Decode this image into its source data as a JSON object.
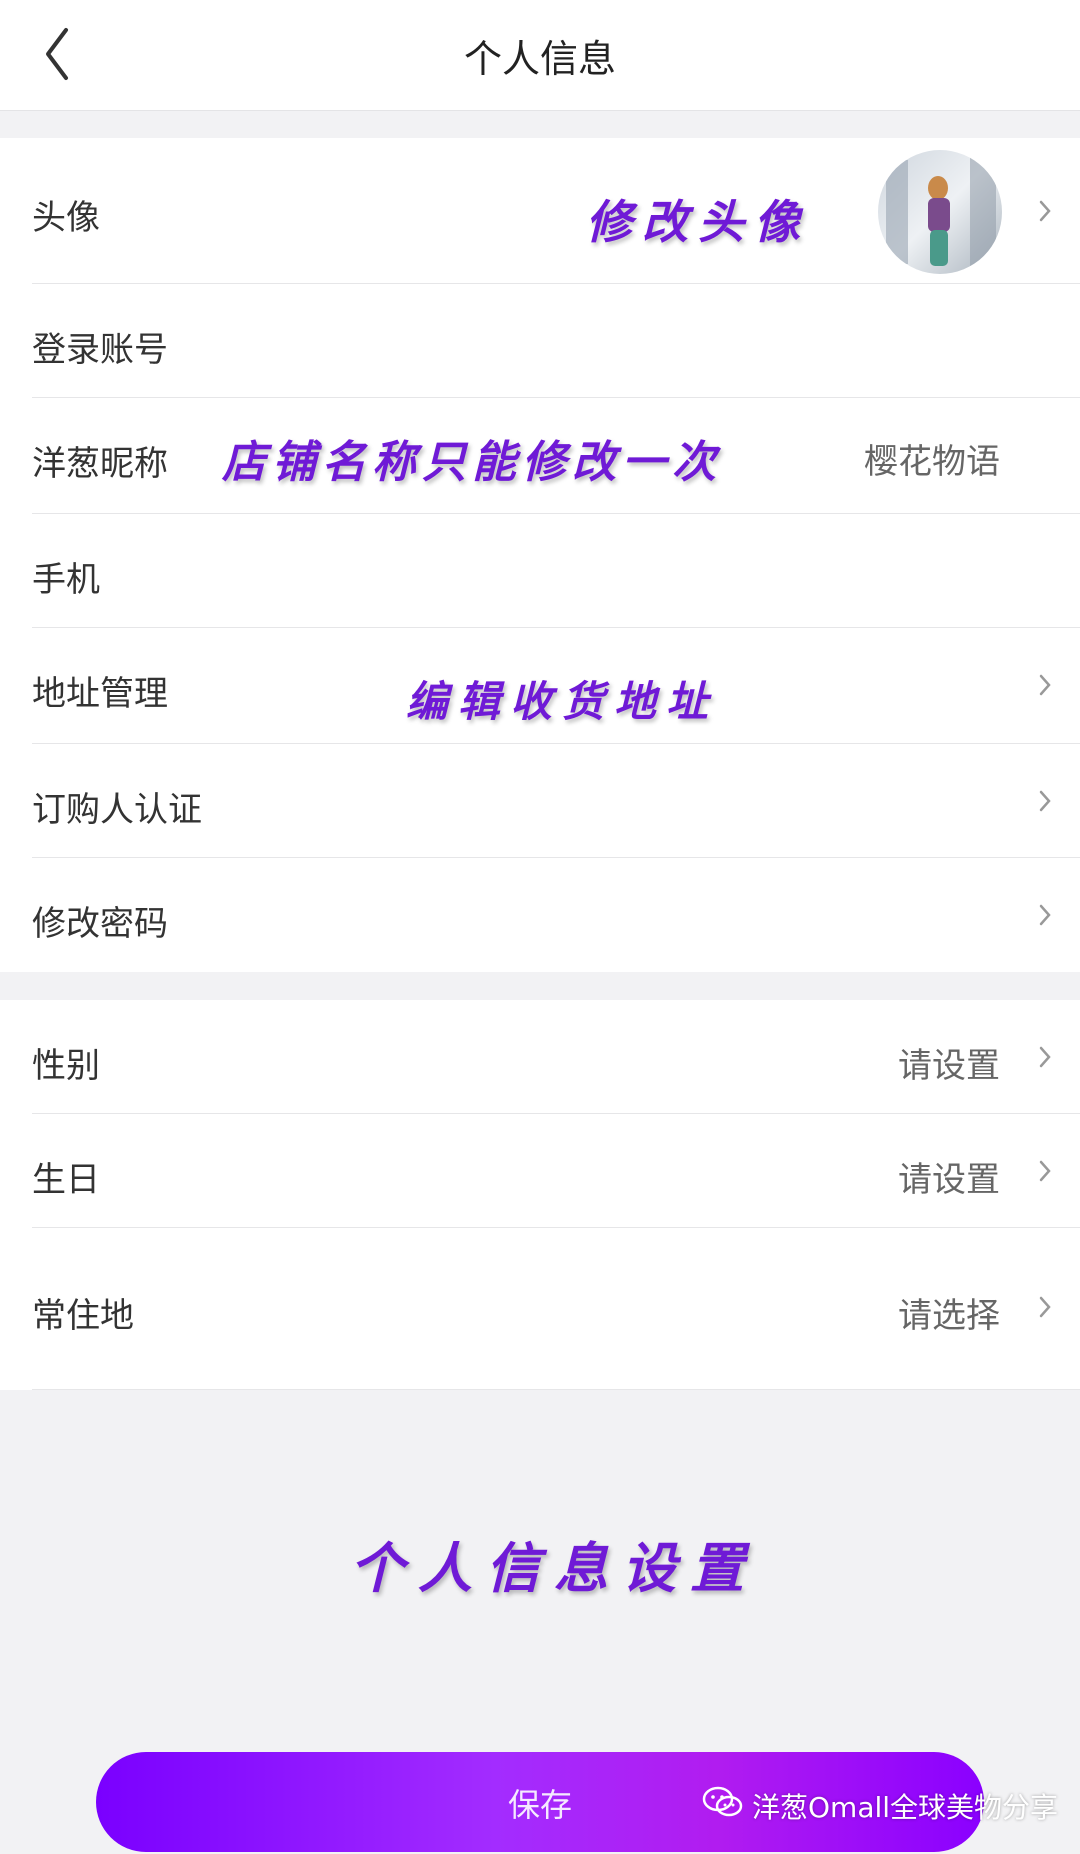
{
  "header": {
    "title": "个人信息"
  },
  "section1": [
    {
      "label": "头像",
      "value": "",
      "chevron": true
    },
    {
      "label": "登录账号",
      "value": "",
      "chevron": false
    },
    {
      "label": "洋葱昵称",
      "value": "樱花物语",
      "chevron": false
    },
    {
      "label": "手机",
      "value": "",
      "chevron": false
    },
    {
      "label": "地址管理",
      "value": "",
      "chevron": true
    },
    {
      "label": "订购人认证",
      "value": "",
      "chevron": true
    },
    {
      "label": "修改密码",
      "value": "",
      "chevron": true
    }
  ],
  "section2": [
    {
      "label": "性别",
      "value": "请设置",
      "chevron": true
    },
    {
      "label": "生日",
      "value": "请设置",
      "chevron": true
    },
    {
      "label": "常住地",
      "value": "请选择",
      "chevron": true
    }
  ],
  "annotations": {
    "avatar": "修改头像",
    "nickname": "店铺名称只能修改一次",
    "address": "编辑收货地址",
    "page": "个人信息设置"
  },
  "save_button": {
    "label": "保存"
  },
  "watermark": {
    "text": "洋葱Omall全球美物分享",
    "icon": "wechat-icon"
  },
  "colors": {
    "accent": "#8a00ff",
    "annotation": "#6f1ad6",
    "background": "#f2f2f4"
  }
}
